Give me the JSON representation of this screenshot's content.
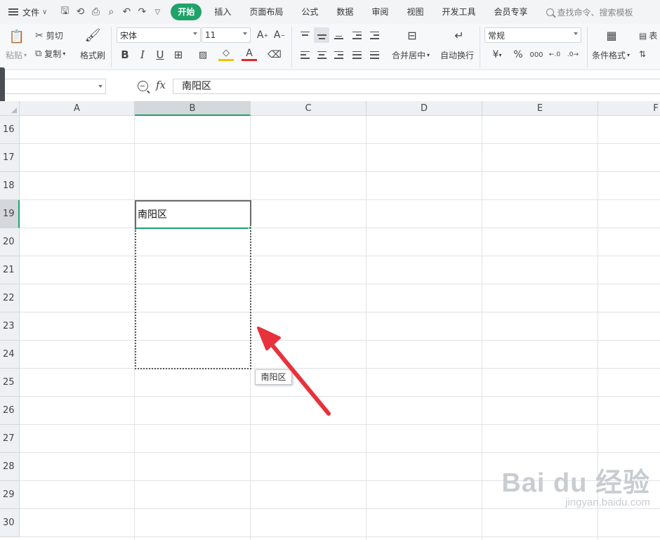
{
  "menubar": {
    "file_label": "文件",
    "tabs": [
      {
        "label": "开始",
        "active": true
      },
      {
        "label": "插入"
      },
      {
        "label": "页面布局"
      },
      {
        "label": "公式"
      },
      {
        "label": "数据"
      },
      {
        "label": "审阅"
      },
      {
        "label": "视图"
      },
      {
        "label": "开发工具"
      },
      {
        "label": "会员专享"
      }
    ],
    "search_label": "查找命令、搜索模板"
  },
  "ribbon": {
    "paste_label": "粘贴",
    "cut_label": "剪切",
    "copy_label": "复制",
    "format_painter_label": "格式刷",
    "font_name": "宋体",
    "font_size": "11",
    "merge_label": "合并居中",
    "wrap_label": "自动换行",
    "number_format": "常规",
    "conditional_label": "条件格式",
    "partial_label": "表"
  },
  "formula_bar": {
    "fx_label": "fx",
    "value": "南阳区"
  },
  "grid": {
    "columns": [
      "A",
      "B",
      "C",
      "D",
      "E",
      "F"
    ],
    "rows": [
      "16",
      "17",
      "18",
      "19",
      "20",
      "21",
      "22",
      "23",
      "24",
      "25",
      "26",
      "27",
      "28",
      "29",
      "30"
    ],
    "selected_column": "B",
    "selected_row": "19",
    "cell_B19": "南阳区",
    "tooltip": "南阳区"
  },
  "colors": {
    "accent": "#1fa36a",
    "arrow": "#e8313a"
  },
  "watermark": {
    "brand": "Bai du 经验",
    "url": "jingyan.baidu.com"
  }
}
